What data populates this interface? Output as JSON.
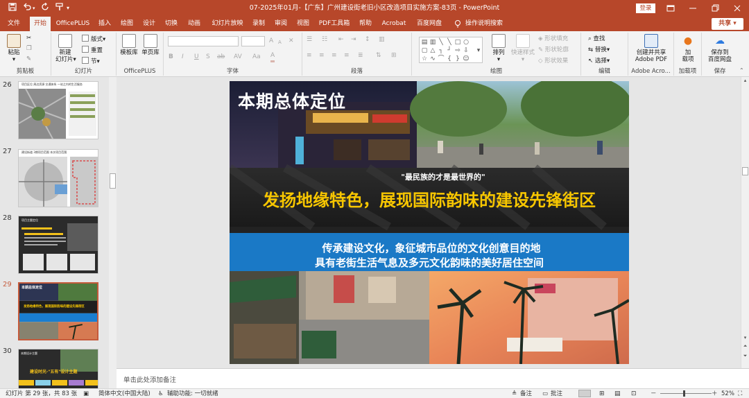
{
  "app": {
    "document_title": "07-2025年01月-【广东】广州建设街老旧小区改造项目实施方案-83页  -  PowerPoint",
    "login_label": "登录"
  },
  "quick_access": {
    "save_icon": "save-icon",
    "undo_icon": "undo-icon",
    "redo_icon": "redo-icon",
    "customize_icon": "customize-icon"
  },
  "tabs": [
    "文件",
    "开始",
    "OfficePLUS",
    "插入",
    "绘图",
    "设计",
    "切换",
    "动画",
    "幻灯片放映",
    "录制",
    "审阅",
    "视图",
    "PDF工具箱",
    "帮助",
    "Acrobat",
    "百度网盘",
    "操作说明搜索"
  ],
  "active_tab": "开始",
  "share_label": "共享",
  "ribbon": {
    "clipboard": {
      "label": "剪贴板",
      "paste": "粘贴"
    },
    "slides": {
      "label": "幻灯片",
      "new_slide": "新建",
      "new_slide2": "幻灯片",
      "layout": "版式",
      "reset": "重置",
      "section": "节"
    },
    "officeplus": {
      "label": "OfficePLUS",
      "templates": "模板库",
      "single_page": "单页库"
    },
    "font": {
      "label": "字体",
      "bold": "B",
      "italic": "I",
      "underline": "U",
      "strike": "S",
      "shadow": "ab",
      "spacing": "AV",
      "case": "Aa",
      "color": "A",
      "grow": "A",
      "shrink": "A"
    },
    "paragraph": {
      "label": "段落"
    },
    "drawing": {
      "label": "绘图",
      "arrange": "排列",
      "quick_styles": "快速样式",
      "fill": "形状填充",
      "outline": "形状轮廓",
      "effects": "形状效果"
    },
    "editing": {
      "label": "编辑",
      "find": "查找",
      "replace": "替换",
      "select": "选择"
    },
    "adobe": {
      "label": "Adobe Acro...",
      "create": "创建并共享",
      "create2": "Adobe PDF"
    },
    "addins": {
      "label": "加载项",
      "addin": "加",
      "addin2": "载项"
    },
    "save": {
      "label": "保存",
      "save_to": "保存到",
      "save_to2": "百度网盘"
    }
  },
  "thumbnails": [
    {
      "number": "26",
      "caption": "项目区位  周边资源  交通体系  一站之内的生活服务"
    },
    {
      "number": "27",
      "caption": "建设街道  3期项目范围  本次项目范围"
    },
    {
      "number": "28",
      "caption": "项目主题定位"
    },
    {
      "number": "29",
      "caption": "本期总体定位",
      "title": "本期总体定位",
      "line": "发扬地缘特色，展现国际韵味的建设先锋街区"
    },
    {
      "number": "30",
      "caption": "本期设计主题",
      "line": "建设时光·\"五有\"设计主题"
    }
  ],
  "slide": {
    "title": "本期总体定位",
    "quote": "\"最民族的才是最世界的\"",
    "headline": "发扬地缘特色，展现国际韵味的建设先锋街区",
    "blue_line1": "传承建设文化，象征城市品位的文化创意目的地",
    "blue_line2": "具有老街生活气息及多元文化韵味的美好居住空间"
  },
  "notes_placeholder": "单击此处添加备注",
  "status": {
    "slide_info": "幻灯片 第 29 张，共 83 张",
    "language": "简体中文(中国大陆)",
    "accessibility": "辅助功能: 一切就绪",
    "notes_label": "备注",
    "comments_label": "批注",
    "zoom": "52%",
    "zoom_minus": "－",
    "zoom_plus": "＋"
  },
  "colors": {
    "accent": "#b7472a",
    "headline_yellow": "#f7c600",
    "blue_band": "#1a7ed0"
  }
}
